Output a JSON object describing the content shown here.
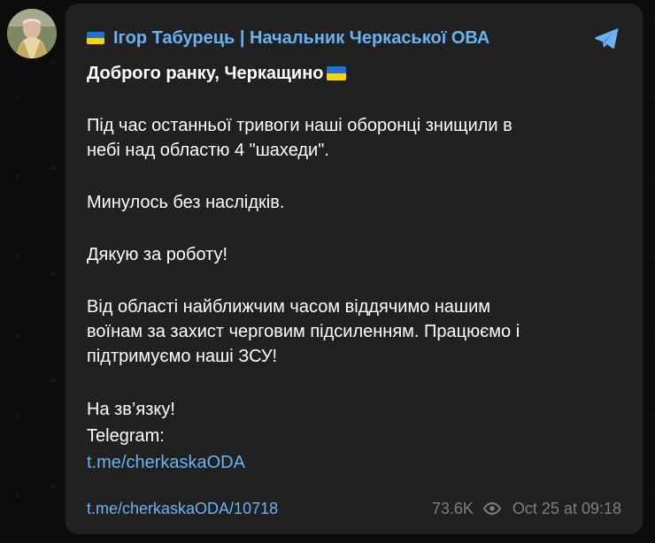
{
  "channel": {
    "name": "Ігор Табурець | Начальник Черкаської ОВА",
    "flag_colors": [
      "#1f73d8",
      "#ffd500"
    ]
  },
  "message": {
    "greeting": "Доброго ранку, Черкащино",
    "paragraphs": [
      [
        "Під час останньої тривоги наші оборонці знищили в",
        "небі над областю 4 \"шахеди\"."
      ],
      [
        "Минулось без наслідків."
      ],
      [
        "Дякую за роботу!"
      ],
      [
        "Від області найближчим часом віддячимо нашим",
        "воїнам за захист черговим підсиленням. Працюємо і",
        "підтримуємо наші ЗСУ!"
      ]
    ],
    "signoff": [
      "На зв’язку!",
      "Telegram:"
    ],
    "signoff_link": "t.me/cherkaskaODA"
  },
  "footer": {
    "post_link": "t.me/cherkaskaODA/10718",
    "views": "73.6K",
    "timestamp": "Oct 25 at 09:18"
  },
  "icons": {
    "share": "telegram-paper-plane-icon",
    "views": "eye-icon"
  },
  "colors": {
    "accent": "#6ab3f3",
    "bubble": "#212121",
    "background": "#0c0c0c",
    "muted": "#7f7f7f"
  }
}
